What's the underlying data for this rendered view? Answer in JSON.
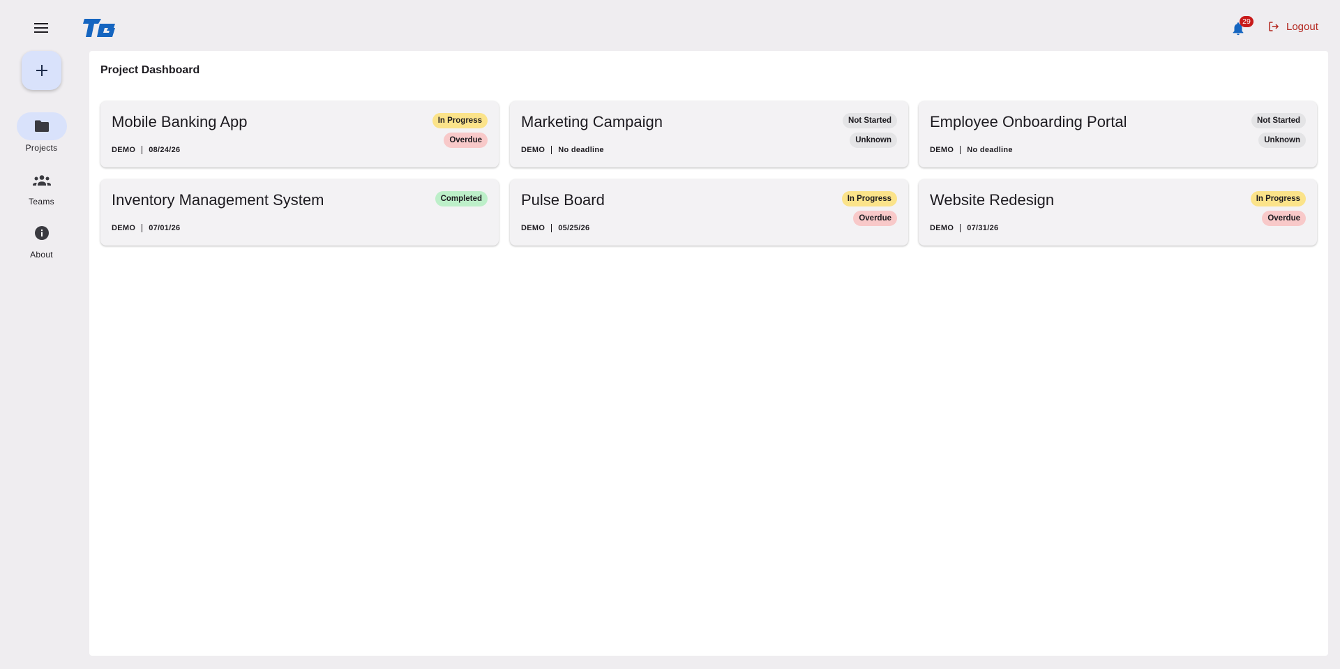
{
  "header": {
    "logo_text": "TG",
    "notifications_count": "29",
    "logout_label": "Logout"
  },
  "rail": {
    "items": [
      {
        "label": "Projects",
        "icon": "folder-icon",
        "active": true
      },
      {
        "label": "Teams",
        "icon": "groups-icon",
        "active": false
      },
      {
        "label": "About",
        "icon": "info-icon",
        "active": false
      }
    ]
  },
  "main": {
    "title": "Project Dashboard",
    "projects": [
      {
        "title": "Mobile Banking App",
        "org": "DEMO",
        "deadline": "08/24/26",
        "status": "In Progress",
        "due": "Overdue"
      },
      {
        "title": "Marketing Campaign",
        "org": "DEMO",
        "deadline": "No deadline",
        "status": "Not Started",
        "due": "Unknown"
      },
      {
        "title": "Employee Onboarding Portal",
        "org": "DEMO",
        "deadline": "No deadline",
        "status": "Not Started",
        "due": "Unknown"
      },
      {
        "title": "Inventory Management System",
        "org": "DEMO",
        "deadline": "07/01/26",
        "status": "Completed",
        "due": ""
      },
      {
        "title": "Pulse Board",
        "org": "DEMO",
        "deadline": "05/25/26",
        "status": "In Progress",
        "due": "Overdue"
      },
      {
        "title": "Website Redesign",
        "org": "DEMO",
        "deadline": "07/31/26",
        "status": "In Progress",
        "due": "Overdue"
      }
    ]
  },
  "colors": {
    "accent": "#1565c0",
    "danger": "#b3261e",
    "in_progress_bg": "#fbe38a",
    "overdue_bg": "#f8c9c9",
    "completed_bg": "#bdefc9",
    "neutral_bg": "#e4e4e6"
  }
}
